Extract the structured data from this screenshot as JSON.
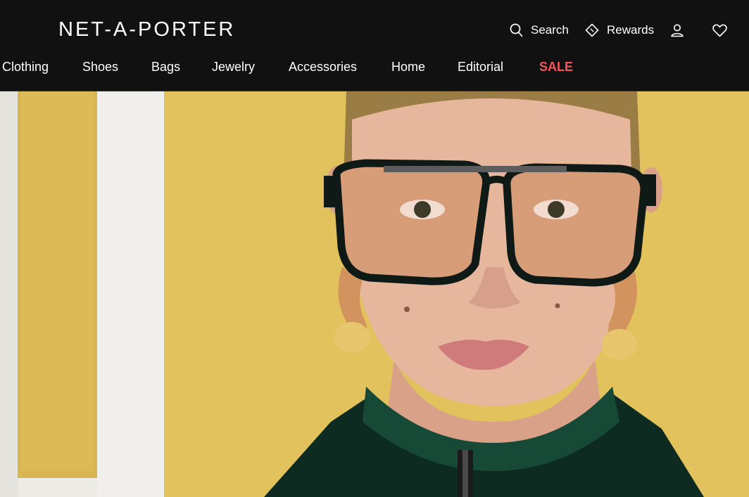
{
  "brand": {
    "logo_text": "NET-A-PORTER"
  },
  "utility": {
    "search_label": "Search",
    "rewards_label": "Rewards"
  },
  "nav": {
    "items": [
      "Clothing",
      "Shoes",
      "Bags",
      "Jewelry",
      "Accessories",
      "Home",
      "Editorial",
      "SALE"
    ]
  },
  "colors": {
    "header_bg": "#111111",
    "text": "#ffffff",
    "sale": "#f2575f",
    "hero_wall": "#e1c25c"
  },
  "icons": {
    "search": "search-icon",
    "rewards": "diamond-icon",
    "account": "user-icon",
    "wishlist": "heart-icon"
  }
}
